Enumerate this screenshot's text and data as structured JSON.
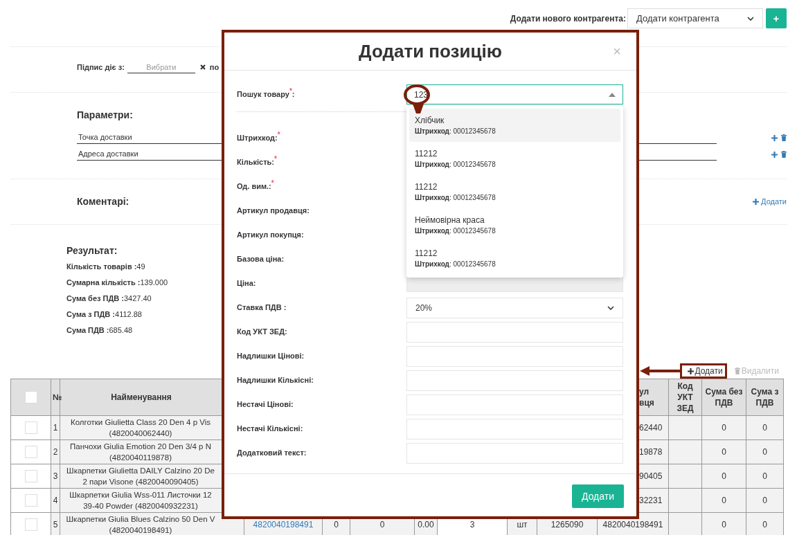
{
  "counterparty": {
    "label": "Додати нового контрагента:",
    "select_value": "Додати контрагента",
    "add_button": "+"
  },
  "signature": {
    "label": "Підпис діє з:",
    "from_placeholder": "Вибрати",
    "to_label": "по"
  },
  "parameters": {
    "title": "Параметри:",
    "rows": [
      {
        "text": "Точка доставки"
      },
      {
        "text": "Адреса доставки"
      }
    ]
  },
  "comments": {
    "title": "Коментарі:",
    "add_link": "Додати"
  },
  "result": {
    "title": "Результат:",
    "lines": [
      "**Кількість товарів :**49",
      "**Сумарна кількість :**139.000",
      "**Сума без ПДВ :**3427.40",
      "**Сума з ПДВ :**4112.88",
      "**Сума ПДВ :**685.48"
    ]
  },
  "table_actions": {
    "add": "Додати",
    "delete": "Видалити",
    "delete_disabled": true
  },
  "table": {
    "columns": [
      {
        "kind": "checkbox",
        "checked": false
      },
      {
        "label_lines": [
          "№"
        ]
      },
      {
        "label_lines": [
          "Найменування"
        ]
      },
      {
        "label_lines": [
          "ул",
          "вця"
        ]
      },
      {
        "label_lines": [
          "Код УКТ ЗЕД"
        ]
      },
      {
        "label_lines": [
          "Сума без ПДВ"
        ]
      },
      {
        "label_lines": [
          "Сума з ПДВ"
        ]
      }
    ],
    "rows": [
      {
        "checked": false,
        "number": "1",
        "name": [
          "Колготки Giulietta Class 20 Den 4 p Vis",
          "(4820040062440)"
        ],
        "buyer_article": "62440",
        "sum_net": "0",
        "sum_gross": "0"
      },
      {
        "checked": false,
        "number": "2",
        "name": [
          "Панчохи Giulia Emotion 20 Den 3/4 p N",
          "(4820040119878)"
        ],
        "buyer_article": "19878",
        "sum_net": "0",
        "sum_gross": "0"
      },
      {
        "checked": false,
        "number": "3",
        "name": [
          "Шкарпетки Giulietta DAILY Calzino 20 De",
          "2 пари Visone (4820040090405)"
        ],
        "buyer_article": "90405",
        "sum_net": "0",
        "sum_gross": "0"
      },
      {
        "checked": false,
        "number": "4",
        "name": [
          "Шкарпетки Giulia Wss-011 Листочки 12",
          "39-40 Powder (4820040932231)"
        ],
        "buyer_article": "32231",
        "sum_net": "0",
        "sum_gross": "0"
      },
      {
        "checked": false,
        "number": "5",
        "name": [
          "Шкарпетки Giulia Blues Calzino 50 Den V",
          "(4820040198491)"
        ],
        "barcode": "4820040198491",
        "column_5": "0",
        "column_6": "0",
        "column_7": "0.00",
        "column_8": "3",
        "column_9": "шт",
        "column_10": "1265090",
        "buyer_article": "4820040198491",
        "sum_net": "0",
        "sum_gross": "0"
      }
    ]
  },
  "modal": {
    "title": "Додати позицію",
    "close": "×",
    "fields": [
      {
        "label": "Пошук товару$^{*}$:",
        "kind": "search",
        "value": "123"
      },
      {
        "label": "Штрихкод:$^{*}$",
        "kind": "covered"
      },
      {
        "label": "Кількість:$^{*}$",
        "kind": "covered"
      },
      {
        "label": "Од. вим.:$^{*}$",
        "kind": "covered"
      },
      {
        "label": "Артикул продавця:",
        "kind": "covered"
      },
      {
        "label": "Артикул покупця:",
        "kind": "covered"
      },
      {
        "label": "Базова ціна:",
        "kind": "covered"
      },
      {
        "label": "Ціна:",
        "kind": "disabled"
      },
      {
        "label": "Ставка ПДВ :",
        "kind": "select",
        "value": "20%"
      },
      {
        "label": "Код УКТ ЗЕД:",
        "kind": "text"
      },
      {
        "label": "Надлишки Цінові:",
        "kind": "text"
      },
      {
        "label": "Надлишки Кількісні:",
        "kind": "text"
      },
      {
        "label": "Нестачі Цінові:",
        "kind": "text"
      },
      {
        "label": "Нестачі Кількісні:",
        "kind": "text"
      },
      {
        "label": "Додатковий текст:",
        "kind": "text"
      }
    ],
    "suggestions": [
      {
        "title": "Хлібчик",
        "detail": "**Штрихкод**: 00012345678",
        "selected": true
      },
      {
        "title": "11212",
        "detail": "**Штрихкод**: 00012345678",
        "selected": false
      },
      {
        "title": "11212",
        "detail": "**Штрихкод**: 00012345678",
        "selected": false
      },
      {
        "title": "Неймовірна краса",
        "detail": "**Штрихкод**: 00012345678",
        "selected": false
      },
      {
        "title": "11212",
        "detail": "**Штрихкод**: 00012345678",
        "selected": false
      }
    ],
    "submit": "Додати"
  }
}
